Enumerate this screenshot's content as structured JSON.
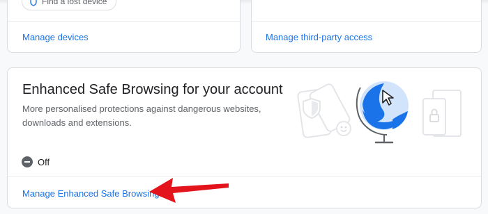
{
  "top_cards": {
    "left": {
      "chip_label": "Find a lost device",
      "link": "Manage devices"
    },
    "right": {
      "link": "Manage third-party access"
    }
  },
  "esb": {
    "title": "Enhanced Safe Browsing for your account",
    "description": "More personalised protections against dangerous websites, downloads and extensions.",
    "status": "Off",
    "status_icon": "minus-circle-icon",
    "link": "Manage Enhanced Safe Browsing"
  },
  "colors": {
    "link": "#1a73e8",
    "accent_blue": "#1a73e8",
    "arrow": "#e3141b"
  }
}
